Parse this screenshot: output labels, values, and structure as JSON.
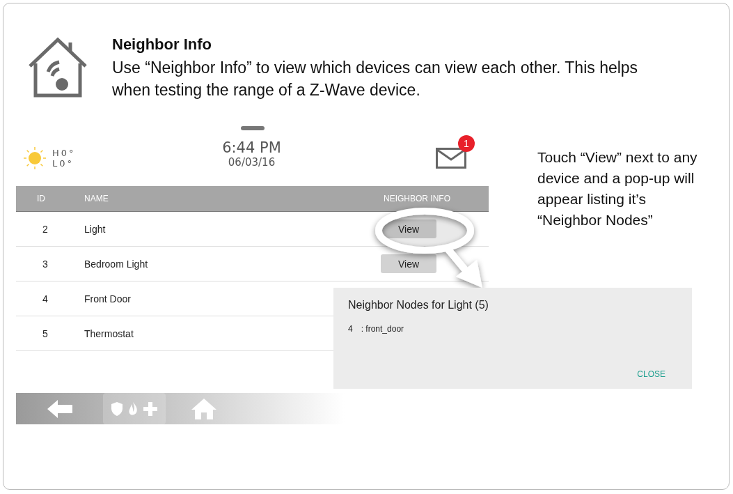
{
  "intro": {
    "title": "Neighbor Info",
    "body": "Use “Neighbor Info” to view which devices can view each other. This helps when testing the range of a Z-Wave device."
  },
  "status_bar": {
    "high": "H0°",
    "low": "L0°",
    "time": "6:44 PM",
    "date": "06/03/16",
    "unread_badge": "1"
  },
  "table": {
    "columns": [
      "ID",
      "NAME",
      "NEIGHBOR INFO"
    ],
    "rows": [
      {
        "id": "2",
        "name": "Light",
        "kind": "view",
        "button": "View"
      },
      {
        "id": "3",
        "name": "Bedroom Light",
        "kind": "view",
        "button": "View"
      },
      {
        "id": "4",
        "name": "Front Door",
        "kind": "covered"
      },
      {
        "id": "5",
        "name": "Thermostat",
        "kind": "none"
      }
    ]
  },
  "popup": {
    "title": "Neighbor Nodes for Light (5)",
    "nodes": [
      {
        "id": "4",
        "name": ": front_door"
      }
    ],
    "close": "CLOSE"
  },
  "hint": "Touch “View” next to any device and a pop-up will appear listing it’s “Neighbor Nodes”"
}
